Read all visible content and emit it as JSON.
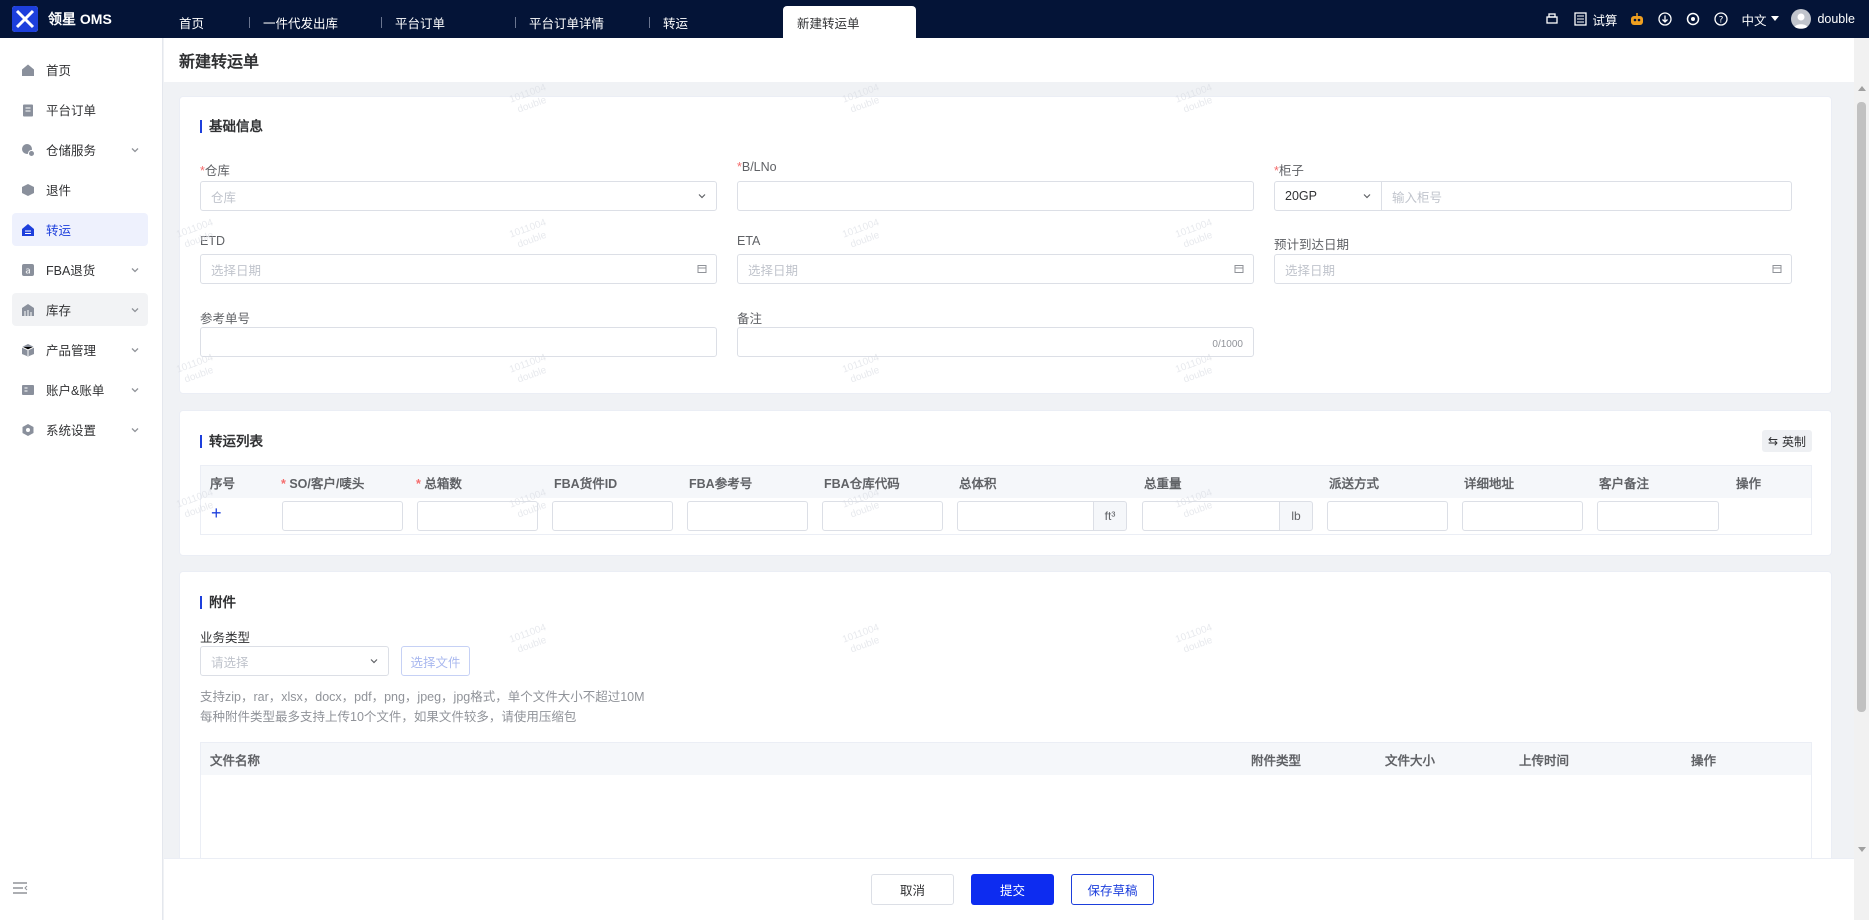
{
  "app": {
    "name": "领星 OMS"
  },
  "tabs": [
    {
      "label": "首页"
    },
    {
      "label": "一件代发出库"
    },
    {
      "label": "平台订单"
    },
    {
      "label": "平台订单详情"
    },
    {
      "label": "转运"
    },
    {
      "label": "新建转运单"
    }
  ],
  "topbar": {
    "trial": "试算",
    "lang": "中文",
    "user": "double"
  },
  "sidebar": {
    "items": [
      {
        "label": "首页"
      },
      {
        "label": "平台订单"
      },
      {
        "label": "仓储服务"
      },
      {
        "label": "退件"
      },
      {
        "label": "转运"
      },
      {
        "label": "FBA退货"
      },
      {
        "label": "库存"
      },
      {
        "label": "产品管理"
      },
      {
        "label": "账户&账单"
      },
      {
        "label": "系统设置"
      }
    ]
  },
  "page": {
    "title": "新建转运单"
  },
  "basic": {
    "title": "基础信息",
    "warehouse_label": "仓库",
    "warehouse_placeholder": "仓库",
    "bl_label": "B/LNo",
    "container_label": "柜子",
    "container_type": "20GP",
    "container_placeholder": "输入柜号",
    "etd_label": "ETD",
    "etd_placeholder": "选择日期",
    "eta_label": "ETA",
    "eta_placeholder": "选择日期",
    "arrival_label": "预计到达日期",
    "arrival_placeholder": "选择日期",
    "ref_label": "参考单号",
    "remark_label": "备注",
    "remark_count": "0/1000"
  },
  "transfer": {
    "title": "转运列表",
    "unit_toggle": "英制",
    "columns": [
      "序号",
      "SO/客户/唛头",
      "总箱数",
      "FBA货件ID",
      "FBA参考号",
      "FBA仓库代码",
      "总体积",
      "总重量",
      "派送方式",
      "详细地址",
      "客户备注",
      "操作"
    ],
    "volume_unit": "ft³",
    "weight_unit": "lb"
  },
  "attach": {
    "title": "附件",
    "type_label": "业务类型",
    "type_placeholder": "请选择",
    "select_file": "选择文件",
    "hint1": "支持zip，rar，xlsx，docx，pdf，png，jpeg，jpg格式，单个文件大小不超过10M",
    "hint2": "每种附件类型最多支持上传10个文件，如果文件较多，请使用压缩包",
    "columns": [
      "文件名称",
      "附件类型",
      "文件大小",
      "上传时间",
      "操作"
    ]
  },
  "footer": {
    "cancel": "取消",
    "submit": "提交",
    "draft": "保存草稿"
  },
  "watermark": {
    "line1": "1011004",
    "line2": "double"
  },
  "colors": {
    "primary": "#1d3fdc",
    "topbar": "#041437"
  }
}
